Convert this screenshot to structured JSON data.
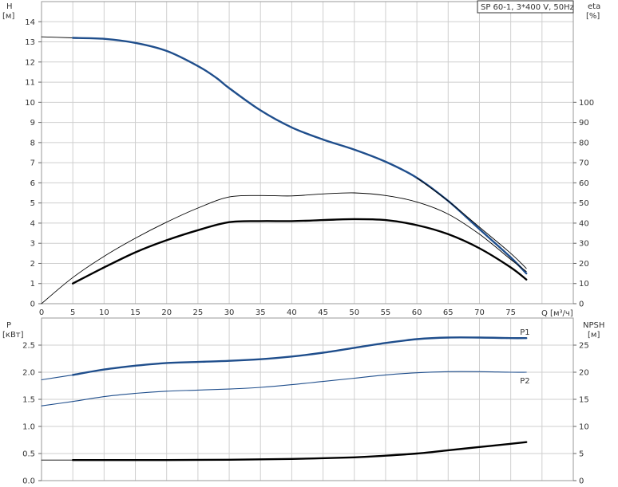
{
  "title": "SP 60-1, 3*400 V, 50Hz",
  "colors": {
    "blue": "#1f4e8c",
    "black": "#000000"
  },
  "chart_data": [
    {
      "type": "line",
      "name": "head-efficiency",
      "xlabel": "Q [м³/ч]",
      "ylabel_left": [
        "H",
        "[м]"
      ],
      "ylabel_right": [
        "eta",
        "[%]"
      ],
      "x_ticks": [
        "0",
        "5",
        "10",
        "15",
        "20",
        "25",
        "30",
        "35",
        "40",
        "45",
        "50",
        "55",
        "60",
        "65",
        "70",
        "75"
      ],
      "y_ticks_left": [
        "0",
        "1",
        "2",
        "3",
        "4",
        "5",
        "6",
        "7",
        "8",
        "9",
        "10",
        "11",
        "12",
        "13",
        "14"
      ],
      "y_ticks_right": [
        "0",
        "10",
        "20",
        "30",
        "40",
        "50",
        "60",
        "70",
        "80",
        "90",
        "100"
      ],
      "xlim": [
        0,
        85
      ],
      "ylim_left": [
        0,
        15
      ],
      "ylim_right": [
        0,
        150
      ],
      "grid": true,
      "series": [
        {
          "key": "h_ext",
          "axis": "left",
          "style": "thin",
          "x": [
            0,
            5
          ],
          "y": [
            13.25,
            13.2
          ]
        },
        {
          "key": "h",
          "axis": "left",
          "style": "blue",
          "x": [
            5,
            10,
            15,
            20,
            25,
            28,
            30,
            35,
            40,
            45,
            50,
            55,
            60,
            65,
            70,
            75,
            77.5
          ],
          "y": [
            13.2,
            13.15,
            12.95,
            12.55,
            11.8,
            11.2,
            10.7,
            9.6,
            8.75,
            8.15,
            7.65,
            7.05,
            6.25,
            5.1,
            3.7,
            2.3,
            1.5
          ]
        },
        {
          "key": "h_thin",
          "axis": "left",
          "style": "thin",
          "x": [
            60,
            65,
            70,
            75,
            77.5
          ],
          "y": [
            6.25,
            5.1,
            3.8,
            2.5,
            1.75
          ]
        },
        {
          "key": "eta1",
          "axis": "right",
          "style": "thin",
          "x": [
            0,
            5,
            10,
            15,
            20,
            25,
            30,
            35,
            40,
            45,
            50,
            55,
            60,
            65,
            70,
            75,
            77.5
          ],
          "y": [
            0,
            13,
            23.5,
            32.5,
            40.5,
            47.5,
            53,
            53.7,
            53.5,
            54.5,
            55,
            53.7,
            50.5,
            44.5,
            34.5,
            22,
            16
          ]
        },
        {
          "key": "eta2",
          "axis": "right",
          "style": "black",
          "x": [
            5,
            10,
            15,
            20,
            25,
            30,
            35,
            40,
            45,
            50,
            55,
            60,
            65,
            70,
            75,
            77.5
          ],
          "y": [
            10,
            18,
            25.5,
            31.5,
            36.5,
            40.5,
            41,
            41,
            41.5,
            42,
            41.5,
            39,
            34.5,
            27.5,
            18,
            12
          ]
        }
      ]
    },
    {
      "type": "line",
      "name": "power-npsh",
      "ylabel_left": [
        "P",
        "[кВт]"
      ],
      "ylabel_right": [
        "NPSH",
        "[м]"
      ],
      "y_ticks_left": [
        "0.0",
        "0.5",
        "1.0",
        "1.5",
        "2.0",
        "2.5"
      ],
      "y_ticks_right": [
        "0",
        "5",
        "10",
        "15",
        "20",
        "25"
      ],
      "xlim": [
        0,
        85
      ],
      "ylim_left": [
        0,
        3.0
      ],
      "ylim_right": [
        0,
        30
      ],
      "grid": true,
      "series": [
        {
          "key": "p1_ext",
          "axis": "left",
          "style": "thin-blue",
          "x": [
            0,
            5
          ],
          "y": [
            1.86,
            1.95
          ]
        },
        {
          "key": "p1",
          "axis": "left",
          "style": "blue",
          "label": "P1",
          "x": [
            5,
            10,
            15,
            20,
            25,
            30,
            35,
            40,
            45,
            50,
            55,
            60,
            65,
            70,
            75,
            77.5
          ],
          "y": [
            1.95,
            2.05,
            2.12,
            2.17,
            2.19,
            2.21,
            2.24,
            2.29,
            2.36,
            2.45,
            2.54,
            2.61,
            2.64,
            2.64,
            2.63,
            2.63
          ]
        },
        {
          "key": "p2",
          "axis": "left",
          "style": "thin-blue",
          "label": "P2",
          "x": [
            0,
            5,
            10,
            15,
            20,
            25,
            30,
            35,
            40,
            45,
            50,
            55,
            60,
            65,
            70,
            75,
            77.5
          ],
          "y": [
            1.38,
            1.46,
            1.55,
            1.61,
            1.65,
            1.67,
            1.69,
            1.72,
            1.77,
            1.83,
            1.89,
            1.95,
            1.99,
            2.01,
            2.01,
            2.0,
            2.0
          ]
        },
        {
          "key": "npsh_ext",
          "axis": "right",
          "style": "thin",
          "x": [
            0,
            5
          ],
          "y": [
            3.8,
            3.8
          ]
        },
        {
          "key": "npsh",
          "axis": "right",
          "style": "black",
          "x": [
            5,
            10,
            20,
            30,
            40,
            50,
            55,
            60,
            65,
            70,
            75,
            77.5
          ],
          "y": [
            3.8,
            3.8,
            3.8,
            3.85,
            4.0,
            4.3,
            4.6,
            5.0,
            5.6,
            6.2,
            6.8,
            7.1
          ]
        }
      ]
    }
  ]
}
